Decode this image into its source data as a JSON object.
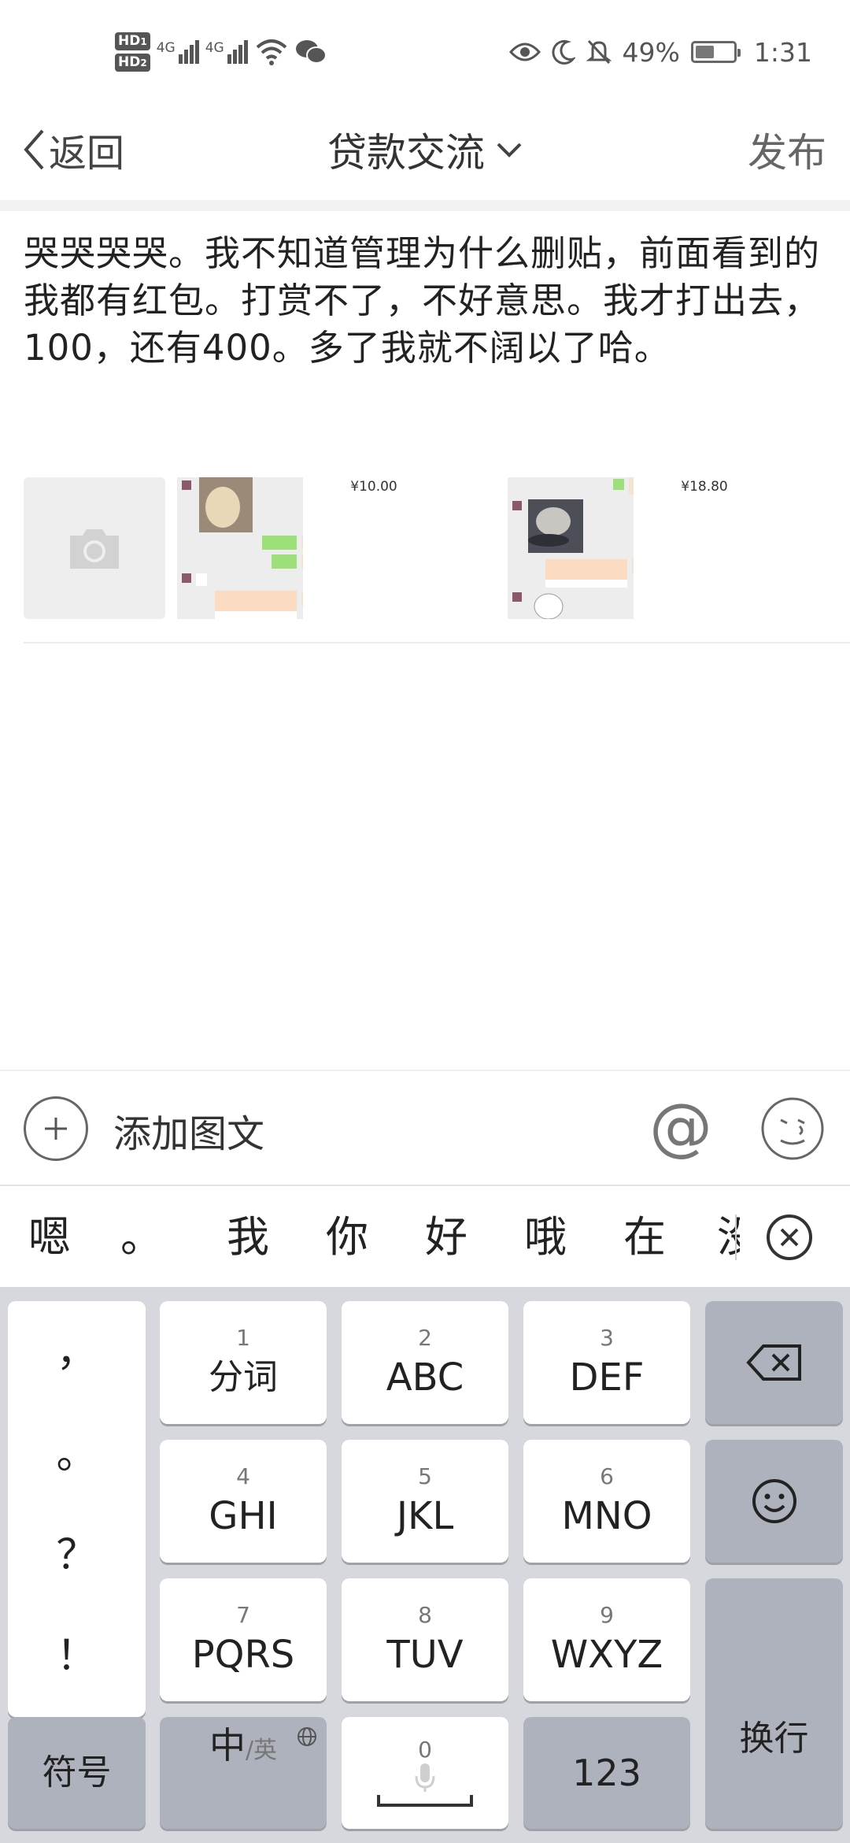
{
  "status_bar": {
    "hd1": "HD",
    "hd2": "HD",
    "hd1_sub": "1",
    "hd2_sub": "2",
    "net1": "4G",
    "net2": "4G",
    "battery_pct": "49%",
    "battery_level": 0.49,
    "time": "1:31",
    "icons": [
      "wifi-icon",
      "wechat-icon",
      "eye-icon",
      "moon-icon",
      "bell-off-icon",
      "battery-icon"
    ]
  },
  "header": {
    "back_label": "返回",
    "title": "贷款交流",
    "publish_label": "发布"
  },
  "post": {
    "text": "哭哭哭哭。我不知道管理为什么删贴，前面看到的我都有红包。打赏不了，不好意思。我才打出去，100，还有400。多了我就不阔以了哈。"
  },
  "thumbnails": {
    "amount_1": "¥10.00",
    "amount_2": "¥18.80"
  },
  "bottom_bar": {
    "add_label": "添加图文",
    "at_symbol": "@"
  },
  "candidates": [
    "嗯",
    "。",
    "我",
    "你",
    "好",
    "哦",
    "在",
    "没"
  ],
  "keyboard": {
    "punctuation": [
      "，",
      "。",
      "？",
      "！"
    ],
    "keys": [
      {
        "num": "1",
        "label": "分词"
      },
      {
        "num": "2",
        "label": "ABC"
      },
      {
        "num": "3",
        "label": "DEF"
      },
      {
        "num": "4",
        "label": "GHI"
      },
      {
        "num": "5",
        "label": "JKL"
      },
      {
        "num": "6",
        "label": "MNO"
      },
      {
        "num": "7",
        "label": "PQRS"
      },
      {
        "num": "8",
        "label": "TUV"
      },
      {
        "num": "9",
        "label": "WXYZ"
      }
    ],
    "symbols_label": "符号",
    "lang_main": "中",
    "lang_sub": "/英",
    "space_num": "0",
    "num_label": "123",
    "enter_label": "换行"
  }
}
